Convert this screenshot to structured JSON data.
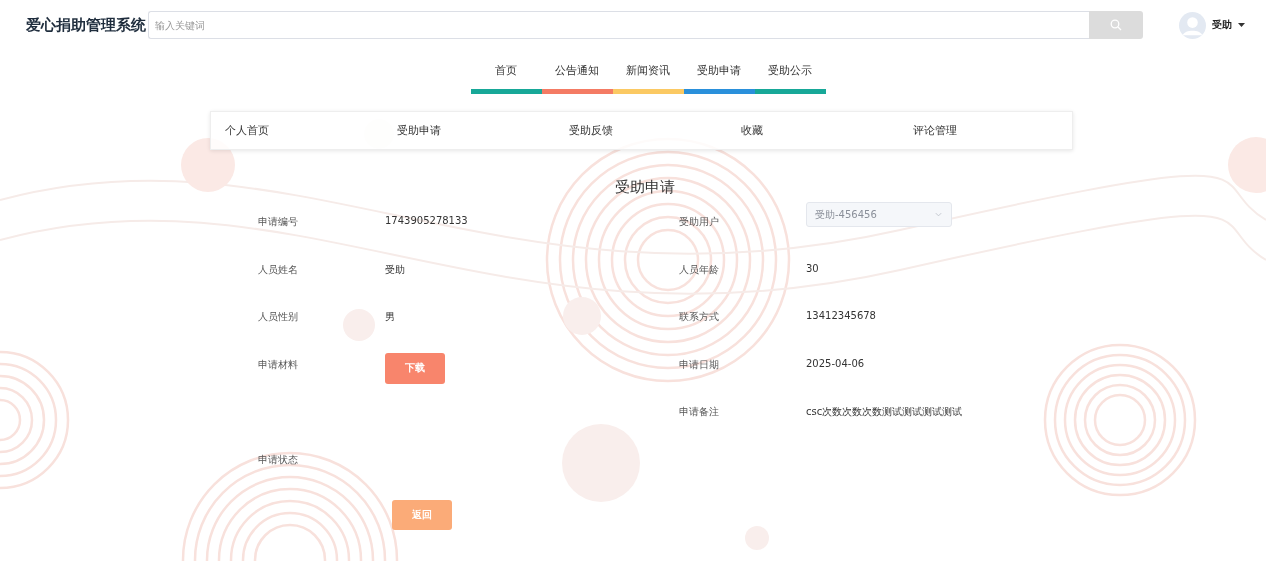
{
  "header": {
    "logo": "爱心捐助管理系统",
    "search": {
      "placeholder": "输入关键词"
    },
    "user": {
      "name": "受助"
    }
  },
  "nav": [
    {
      "label": "首页",
      "color": "#17a898"
    },
    {
      "label": "公告通知",
      "color": "#f47b64"
    },
    {
      "label": "新闻资讯",
      "color": "#fbc963"
    },
    {
      "label": "受助申请",
      "color": "#2a90db"
    },
    {
      "label": "受助公示",
      "color": "#17a898"
    }
  ],
  "subnav": [
    "个人首页",
    "受助申请",
    "受助反馈",
    "收藏",
    "评论管理"
  ],
  "title": "受助申请",
  "rows": [
    {
      "left": {
        "label": "申请编号",
        "kind": "text",
        "value": "1743905278133"
      },
      "right": {
        "label": "受助用户",
        "kind": "select",
        "value": "受助-456456",
        "disabled": true
      }
    },
    {
      "left": {
        "label": "人员姓名",
        "kind": "text",
        "value": "受助"
      },
      "right": {
        "label": "人员年龄",
        "kind": "text",
        "value": "30"
      }
    },
    {
      "left": {
        "label": "人员性别",
        "kind": "text",
        "value": "男"
      },
      "right": {
        "label": "联系方式",
        "kind": "text",
        "value": "13412345678"
      }
    },
    {
      "left": {
        "label": "申请材料",
        "kind": "button",
        "value": "下载"
      },
      "right": {
        "label": "申请日期",
        "kind": "text",
        "value": "2025-04-06"
      }
    },
    {
      "right": {
        "label": "申请备注",
        "kind": "text",
        "value": "csc次数次数次数测试测试测试测试"
      }
    },
    {
      "left": {
        "label": "申请状态",
        "kind": "empty"
      }
    }
  ],
  "back_button": "返回"
}
